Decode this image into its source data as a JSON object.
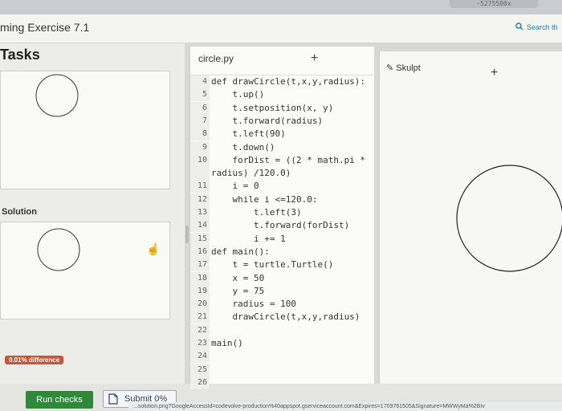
{
  "browser": {
    "tab_fragment": "-5275500x"
  },
  "header": {
    "title": "ming Exercise 7.1",
    "search_placeholder": "Search th",
    "search_icon": "magnifier-icon"
  },
  "left": {
    "tasks_title": "Tasks",
    "solution_label": "Solution",
    "difference_badge": "0.01% difference",
    "hand_icon": "pointer-hand-icon"
  },
  "buttons": {
    "run_checks": "Run checks",
    "submit": "Submit 0%"
  },
  "status_bar": {
    "url": "...solution.png?GoogleAccessId=codevolve-production%40appspot.gserviceaccount.com&Expires=1709761505&Signature=MWWyMa%2BIv"
  },
  "editor": {
    "file_tab": "circle.py",
    "add_button": "+",
    "lines": [
      {
        "n": "4",
        "code": "def drawCircle(t,x,y,radius):"
      },
      {
        "n": "5",
        "code": "    t.up()"
      },
      {
        "n": "6",
        "code": "    t.setposition(x, y)"
      },
      {
        "n": "7",
        "code": "    t.forward(radius)"
      },
      {
        "n": "8",
        "code": "    t.left(90)"
      },
      {
        "n": "9",
        "code": "    t.down()"
      },
      {
        "n": "10",
        "code": "    forDist = ((2 * math.pi *"
      },
      {
        "n": "",
        "code": "radius) /120.0)"
      },
      {
        "n": "11",
        "code": "    i = 0"
      },
      {
        "n": "12",
        "code": "    while i <=120.0:"
      },
      {
        "n": "13",
        "code": "        t.left(3)"
      },
      {
        "n": "14",
        "code": "        t.forward(forDist)"
      },
      {
        "n": "15",
        "code": "        i += 1"
      },
      {
        "n": "16",
        "code": "def main():"
      },
      {
        "n": "17",
        "code": "    t = turtle.Turtle()"
      },
      {
        "n": "18",
        "code": "    x = 50"
      },
      {
        "n": "19",
        "code": "    y = 75"
      },
      {
        "n": "20",
        "code": "    radius = 100"
      },
      {
        "n": "21",
        "code": "    drawCircle(t,x,y,radius)"
      },
      {
        "n": "22",
        "code": ""
      },
      {
        "n": "23",
        "code": "main()"
      },
      {
        "n": "24",
        "code": ""
      },
      {
        "n": "25",
        "code": ""
      },
      {
        "n": "26",
        "code": ""
      }
    ]
  },
  "output": {
    "tab_label": "Skulpt",
    "tab_icon": "pencil-icon",
    "add_button": "+"
  },
  "colors": {
    "run_button": "#2e8a3a",
    "diff_badge": "#c7553a",
    "keyword": "#7a2a8a",
    "number": "#e0701f"
  }
}
